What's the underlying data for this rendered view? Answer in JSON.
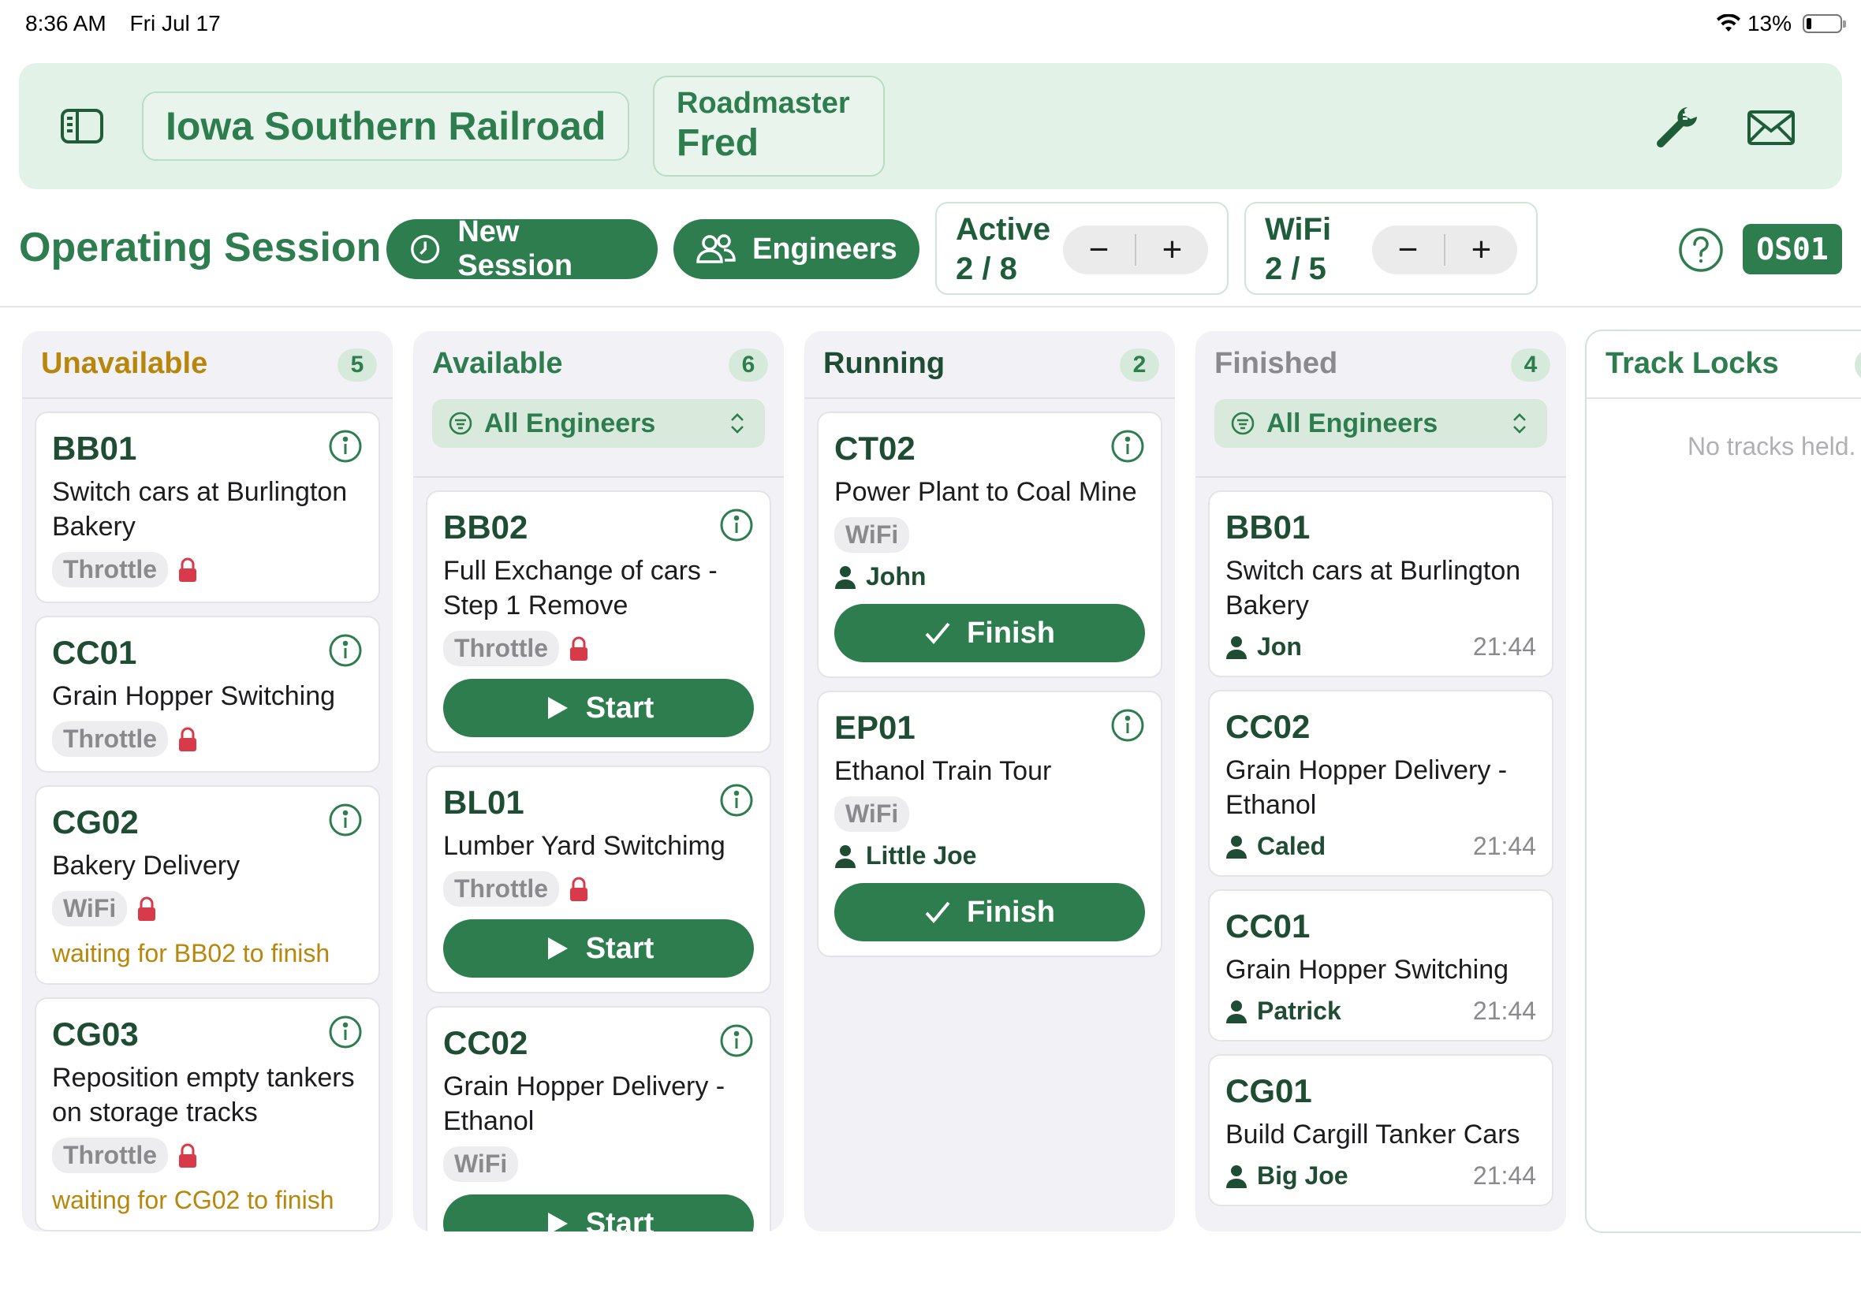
{
  "status_bar": {
    "time": "8:36 AM",
    "date": "Fri Jul 17",
    "battery": "13%"
  },
  "header": {
    "railroad_name": "Iowa Southern Railroad",
    "role": "Roadmaster",
    "user": "Fred",
    "icons": [
      "sidebar-icon",
      "wrench-icon",
      "envelope-icon"
    ]
  },
  "toolbar": {
    "title": "Operating Session",
    "new_session_label": "New Session",
    "engineers_label": "Engineers",
    "active": {
      "label": "Active",
      "value": "2 / 8",
      "minus": "−",
      "plus": "+"
    },
    "wifi": {
      "label": "WiFi",
      "value": "2 / 5",
      "minus": "−",
      "plus": "+"
    },
    "session_code": "OS01"
  },
  "columns": {
    "unavailable": {
      "title": "Unavailable",
      "count": "5",
      "cards": [
        {
          "id": "BB01",
          "desc": "Switch cars at Burlington Bakery",
          "tag": "Throttle",
          "waiting": ""
        },
        {
          "id": "CC01",
          "desc": "Grain Hopper Switching",
          "tag": "Throttle",
          "waiting": ""
        },
        {
          "id": "CG02",
          "desc": "Bakery Delivery",
          "tag": "WiFi",
          "waiting": "waiting for BB02 to finish"
        },
        {
          "id": "CG03",
          "desc": "Reposition empty tankers on storage tracks",
          "tag": "Throttle",
          "waiting": "waiting for CG02 to finish"
        }
      ]
    },
    "available": {
      "title": "Available",
      "count": "6",
      "filter": "All Engineers",
      "start_label": "Start",
      "cards": [
        {
          "id": "BB02",
          "desc": "Full Exchange of cars - Step 1 Remove",
          "tag": "Throttle"
        },
        {
          "id": "BL01",
          "desc": "Lumber Yard Switchimg",
          "tag": "Throttle"
        },
        {
          "id": "CC02",
          "desc": "Grain Hopper Delivery - Ethanol",
          "tag": "WiFi"
        }
      ]
    },
    "running": {
      "title": "Running",
      "count": "2",
      "finish_label": "Finish",
      "cards": [
        {
          "id": "CT02",
          "desc": "Power Plant to Coal Mine",
          "tag": "WiFi",
          "engineer": "John"
        },
        {
          "id": "EP01",
          "desc": "Ethanol Train Tour",
          "tag": "WiFi",
          "engineer": "Little Joe"
        }
      ]
    },
    "finished": {
      "title": "Finished",
      "count": "4",
      "filter": "All Engineers",
      "cards": [
        {
          "id": "BB01",
          "desc": "Switch cars at Burlington Bakery",
          "engineer": "Jon",
          "time": "21:44"
        },
        {
          "id": "CC02",
          "desc": "Grain Hopper Delivery - Ethanol",
          "engineer": "Caled",
          "time": "21:44"
        },
        {
          "id": "CC01",
          "desc": "Grain Hopper Switching",
          "engineer": "Patrick",
          "time": "21:44"
        },
        {
          "id": "CG01",
          "desc": "Build Cargill Tanker Cars",
          "engineer": "Big Joe",
          "time": "21:44"
        }
      ]
    },
    "track_locks": {
      "title": "Track Locks",
      "empty": "No tracks held."
    }
  },
  "colors": {
    "accent": "#2e7d4f",
    "banner": "#e3f2e6",
    "warning": "#b8860b",
    "lock": "#d83a4a"
  }
}
